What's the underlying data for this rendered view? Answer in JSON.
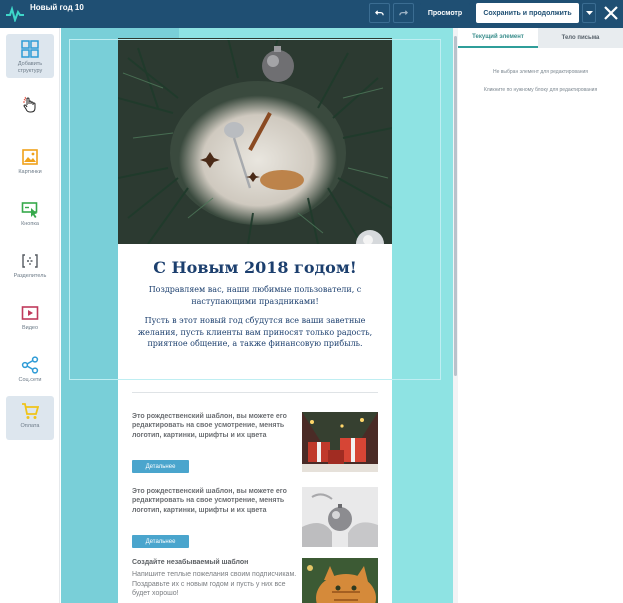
{
  "app": {
    "title": "Новый год 10"
  },
  "toolbar": {
    "undo_icon": "undo-icon",
    "redo_icon": "redo-icon",
    "preview_label": "Просмотр",
    "save_label": "Сохранить и продолжить",
    "caret_icon": "chevron-down-icon",
    "close_icon": "close-icon"
  },
  "sidebar": {
    "items": [
      {
        "label": "Добавить структуру",
        "icon": "grid-icon",
        "color": "#2e9bd6"
      },
      {
        "label": "",
        "icon": "hand-pointer-icon",
        "color": "#e04a3a"
      },
      {
        "label": "Картинки",
        "icon": "image-icon",
        "color": "#f0a21a"
      },
      {
        "label": "Кнопка",
        "icon": "button-click-icon",
        "color": "#36a94b"
      },
      {
        "label": "Разделитель",
        "icon": "divider-icon",
        "color": "#555a60"
      },
      {
        "label": "Видео",
        "icon": "video-icon",
        "color": "#c03a5c"
      },
      {
        "label": "Соц.сети",
        "icon": "share-icon",
        "color": "#2e9bd6"
      },
      {
        "label": "Оплата",
        "icon": "cart-icon",
        "color": "#f0c419"
      }
    ]
  },
  "email": {
    "title": "С Новым 2018 годом!",
    "greeting": "Поздравляем вас, наши любимые пользователи, с наступающими праздниками!",
    "wishes": "Пусть в этот новый год сбудутся все ваши заветные желания, пусть клиенты вам приносят только радость, приятное общение, а также финансовую прибыль.",
    "articles": [
      {
        "text": "Это рождественский шаблон, вы можете его редактировать на свое усмотрение, менять логотип, картинки, шрифты и их цвета",
        "button": "Детальнее"
      },
      {
        "text": "Это рождественский шаблон, вы можете его редактировать на свое усмотрение, менять логотип, картинки, шрифты и их цвета",
        "button": "Детальнее"
      },
      {
        "heading": "Создайте незабываемый шаблон",
        "text": "Напишите теплые пожелания своим подписчикам. Поздравьте их с новым годом и пусть у них все будет хорошо!"
      }
    ]
  },
  "right_panel": {
    "tab_current": "Текущий элемент",
    "tab_body": "Тело письма",
    "no_selection": "Не выбран элемент для редактирования",
    "hint": "Кликните по нужному блоку для редактирования"
  },
  "colors": {
    "topbar": "#1f4f73",
    "canvas": "#79cfd8",
    "panel": "#8ee3e3",
    "title": "#1c3f6e",
    "button": "#4aa5cd"
  }
}
